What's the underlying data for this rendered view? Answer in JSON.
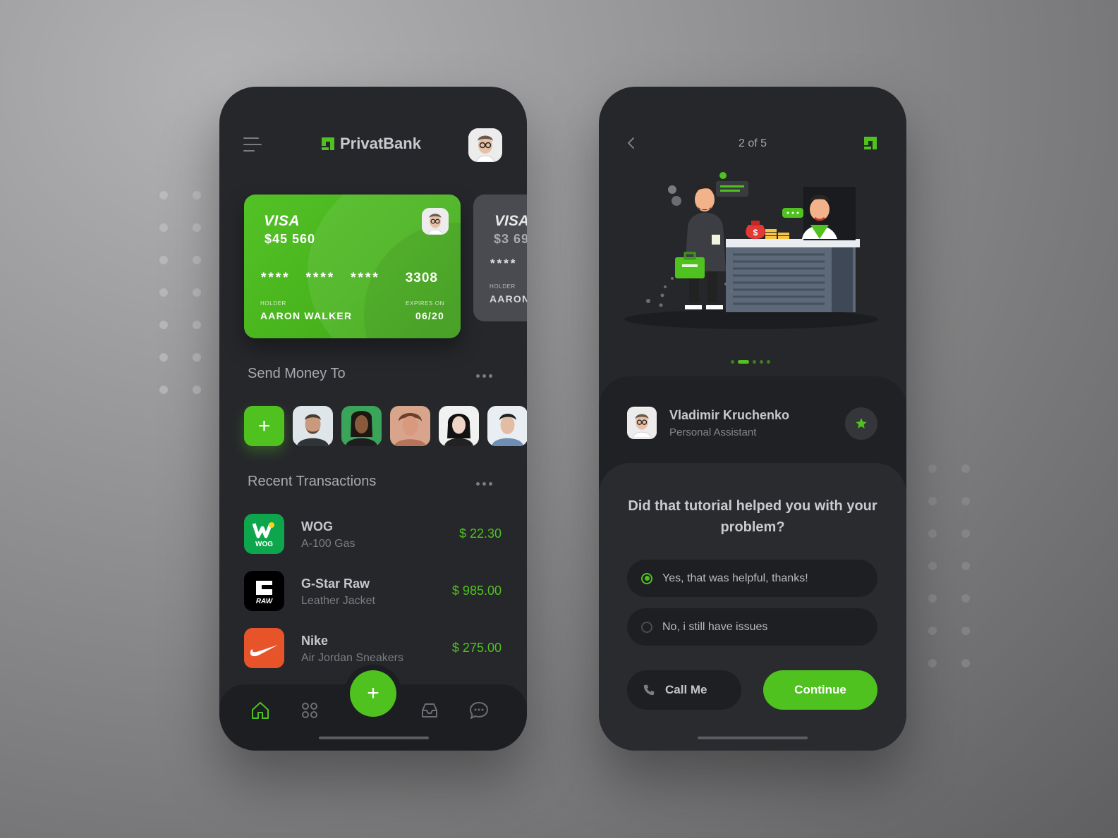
{
  "colors": {
    "accent": "#4fc21f",
    "phone_bg": "#26272b",
    "text_primary": "#c6c7cc",
    "text_secondary": "#7b7c82"
  },
  "left_screen": {
    "brand": "PrivatBank",
    "cards": [
      {
        "network": "VISA",
        "balance": "$45 560",
        "number_groups": [
          "****",
          "****",
          "****",
          "3308"
        ],
        "holder_label": "HOLDER",
        "holder": "AARON WALKER",
        "expiry_label": "EXPIRES ON",
        "expiry": "06/20"
      },
      {
        "network": "VISA",
        "balance": "$3 69",
        "number_groups": [
          "****"
        ],
        "holder_label": "HOLDER",
        "holder": "AARON"
      }
    ],
    "send_money": {
      "title": "Send Money To",
      "add_label": "+",
      "contacts": [
        "contact-1",
        "contact-2",
        "contact-3",
        "contact-4",
        "contact-5"
      ]
    },
    "transactions": {
      "title": "Recent Transactions",
      "items": [
        {
          "merchant": "WOG",
          "description": "A-100 Gas",
          "amount": "$ 22.30",
          "logo_text": "WOG",
          "logo_color": "#0ea64d"
        },
        {
          "merchant": "G-Star Raw",
          "description": "Leather Jacket",
          "amount": "$ 985.00",
          "logo_text": "RAW",
          "logo_color": "#000000"
        },
        {
          "merchant": "Nike",
          "description": "Air Jordan Sneakers",
          "amount": "$ 275.00",
          "logo_text": "",
          "logo_color": "#e8542a"
        }
      ]
    },
    "nav": {
      "items": [
        "home-icon",
        "grid-icon",
        "add-icon",
        "inbox-icon",
        "chat-icon"
      ],
      "fab_label": "+"
    }
  },
  "right_screen": {
    "step": "2 of 5",
    "pager": {
      "total": 5,
      "active": 2
    },
    "assistant": {
      "name": "Vladimir Kruchenko",
      "role": "Personal Assistant"
    },
    "question": "Did that tutorial helped you with your problem?",
    "options": [
      {
        "label": "Yes, that was helpful, thanks!",
        "selected": true
      },
      {
        "label": "No, i still have issues",
        "selected": false
      }
    ],
    "call_label": "Call Me",
    "continue_label": "Continue"
  }
}
